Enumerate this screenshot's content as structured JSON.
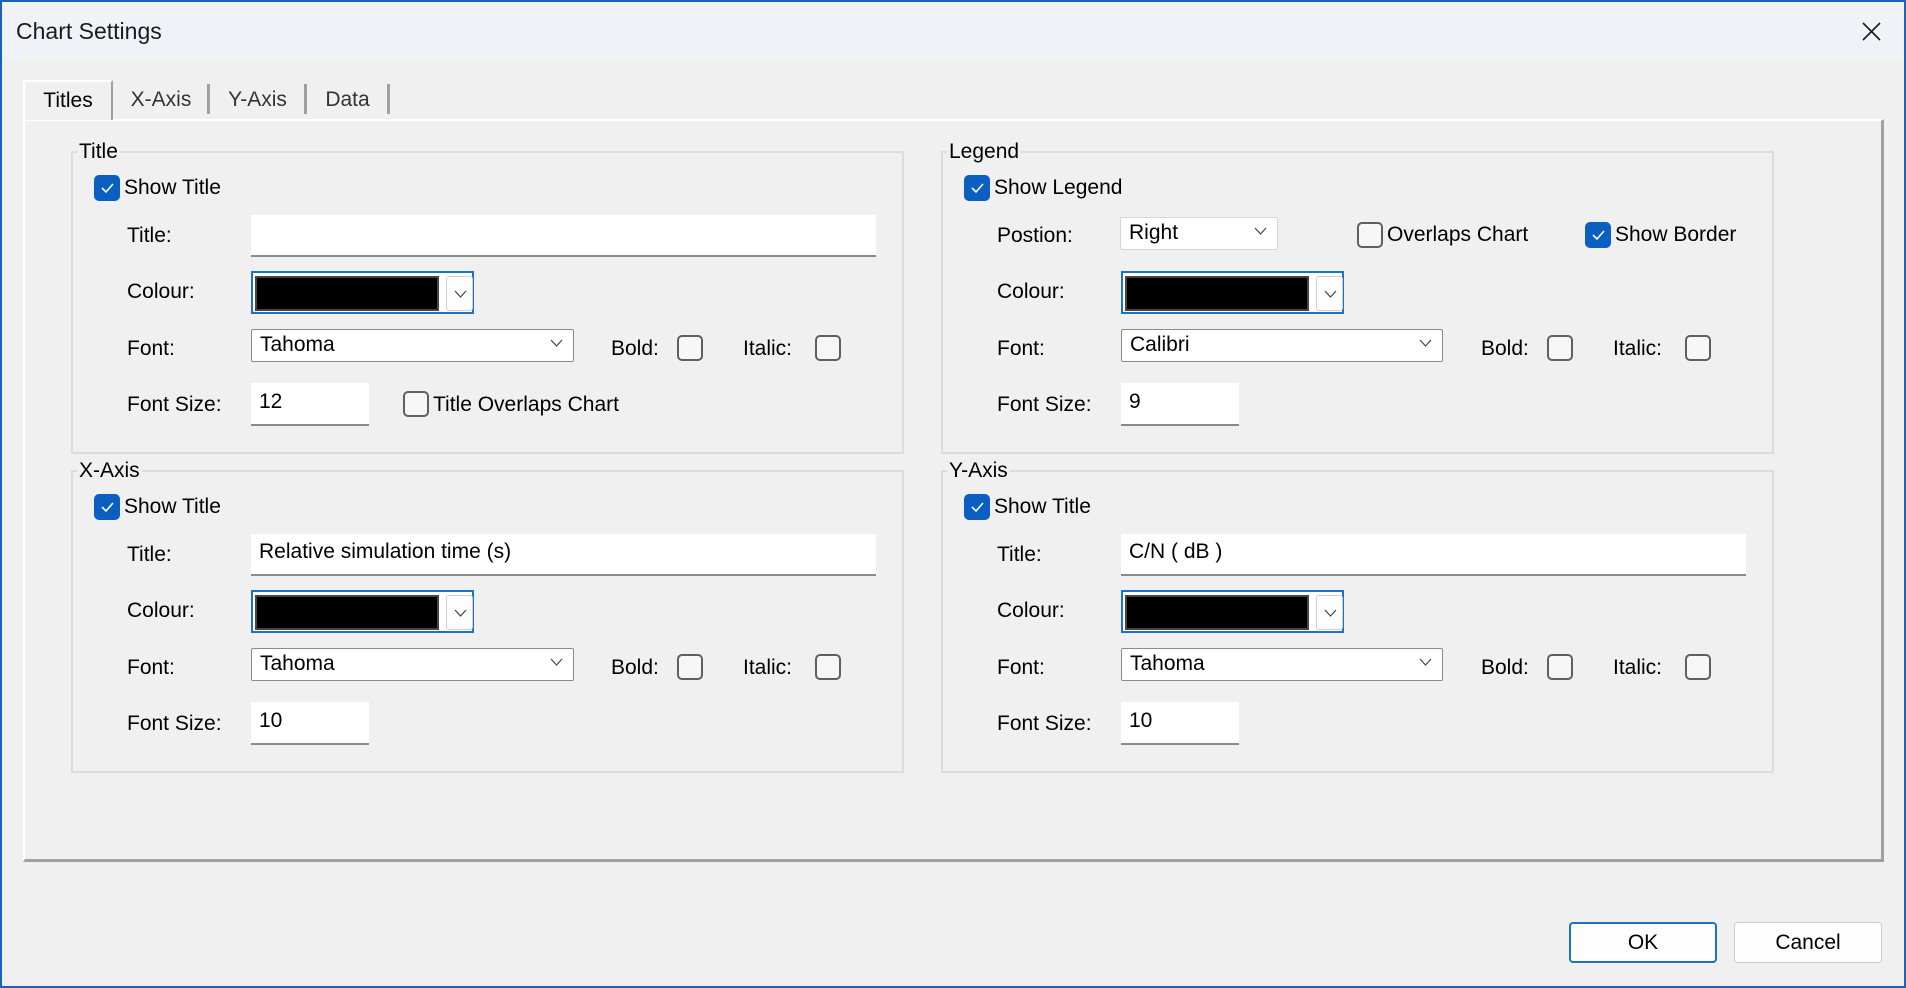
{
  "window": {
    "title": "Chart Settings",
    "close_icon": "close-icon"
  },
  "tabs": [
    {
      "label": "Titles",
      "active": true
    },
    {
      "label": "X-Axis",
      "active": false
    },
    {
      "label": "Y-Axis",
      "active": false
    },
    {
      "label": "Data",
      "active": false
    }
  ],
  "title_group": {
    "label": "Title",
    "show_title": {
      "label": "Show Title",
      "checked": true
    },
    "title_label": "Title:",
    "title_value": "",
    "colour_label": "Colour:",
    "colour_value": "#000000",
    "font_label": "Font:",
    "font_value": "Tahoma",
    "bold_label": "Bold:",
    "bold_checked": false,
    "italic_label": "Italic:",
    "italic_checked": false,
    "font_size_label": "Font Size:",
    "font_size_value": "12",
    "overlaps": {
      "label": "Title Overlaps Chart",
      "checked": false
    }
  },
  "legend_group": {
    "label": "Legend",
    "show_legend": {
      "label": "Show Legend",
      "checked": true
    },
    "position_label": "Postion:",
    "position_value": "Right",
    "overlaps": {
      "label": "Overlaps Chart",
      "checked": false
    },
    "show_border": {
      "label": "Show Border",
      "checked": true
    },
    "colour_label": "Colour:",
    "colour_value": "#000000",
    "font_label": "Font:",
    "font_value": "Calibri",
    "bold_label": "Bold:",
    "bold_checked": false,
    "italic_label": "Italic:",
    "italic_checked": false,
    "font_size_label": "Font Size:",
    "font_size_value": "9"
  },
  "xaxis_group": {
    "label": "X-Axis",
    "show_title": {
      "label": "Show Title",
      "checked": true
    },
    "title_label": "Title:",
    "title_value": "Relative simulation time (s)",
    "colour_label": "Colour:",
    "colour_value": "#000000",
    "font_label": "Font:",
    "font_value": "Tahoma",
    "bold_label": "Bold:",
    "bold_checked": false,
    "italic_label": "Italic:",
    "italic_checked": false,
    "font_size_label": "Font Size:",
    "font_size_value": "10"
  },
  "yaxis_group": {
    "label": "Y-Axis",
    "show_title": {
      "label": "Show Title",
      "checked": true
    },
    "title_label": "Title:",
    "title_value": "C/N ( dB )",
    "colour_label": "Colour:",
    "colour_value": "#000000",
    "font_label": "Font:",
    "font_value": "Tahoma",
    "bold_label": "Bold:",
    "bold_checked": false,
    "italic_label": "Italic:",
    "italic_checked": false,
    "font_size_label": "Font Size:",
    "font_size_value": "10"
  },
  "buttons": {
    "ok_label": "OK",
    "cancel_label": "Cancel"
  },
  "colors": {
    "accent": "#0a5fc1",
    "window_border": "#1565c0",
    "dialog_bg": "#f0f0f0",
    "titlebar_bg": "#eff3f7"
  }
}
